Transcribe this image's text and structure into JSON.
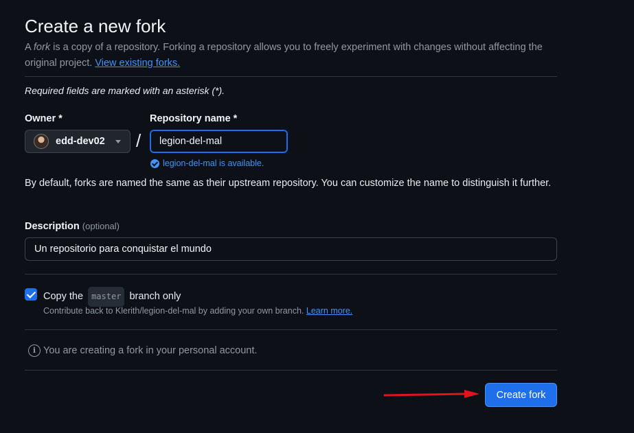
{
  "header": {
    "title": "Create a new fork",
    "intro_prefix": "A ",
    "intro_em": "fork",
    "intro_rest": " is a copy of a repository. Forking a repository allows you to freely experiment with changes without affecting the original project. ",
    "view_forks_link": "View existing forks."
  },
  "form": {
    "required_note": "Required fields are marked with an asterisk (*).",
    "owner_label": "Owner *",
    "owner_value": "edd-dev02",
    "repo_label": "Repository name *",
    "repo_value": "legion-del-mal",
    "availability": "legion-del-mal is available.",
    "slash": "/",
    "naming_note": "By default, forks are named the same as their upstream repository. You can customize the name to distinguish it further.",
    "description_label": "Description",
    "description_optional": "(optional)",
    "description_value": "Un repositorio para conquistar el mundo",
    "copy_prefix": "Copy the",
    "copy_branch": "master",
    "copy_suffix": "branch only",
    "copy_checked": true,
    "contribute_text": "Contribute back to Klerith/legion-del-mal by adding your own branch.",
    "learn_more": "Learn more.",
    "account_note": "You are creating a fork in your personal account.",
    "info_glyph": "i",
    "submit_label": "Create fork"
  },
  "colors": {
    "background": "#0d1117",
    "accent": "#1f6feb",
    "link": "#4493f8",
    "annotation_arrow": "#e3131b"
  },
  "icons": [
    "avatar",
    "chevron-down-icon",
    "check-circle-icon",
    "checkbox-checked-icon",
    "info-icon",
    "red-arrow-annotation"
  ]
}
